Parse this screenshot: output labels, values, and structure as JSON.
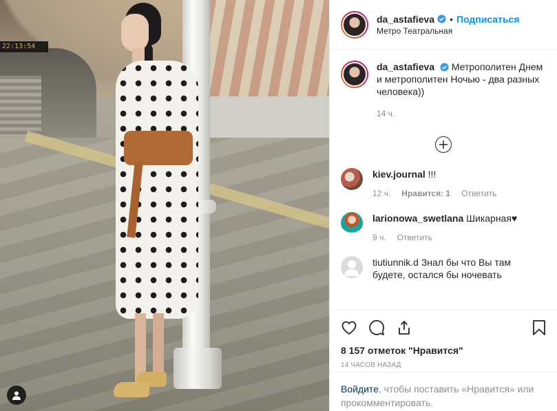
{
  "photo": {
    "station_sign_text": "22:13:54"
  },
  "header": {
    "username": "da_astafieva",
    "separator": "•",
    "follow_label": "Подписаться",
    "location": "Метро Театральная"
  },
  "caption": {
    "username": "da_astafieva",
    "text": "Метрополитен Днем и метрополитен Ночью - два разных человека))",
    "time": "14 ч."
  },
  "comments": [
    {
      "username": "kiev.journal",
      "text": "!!!",
      "time": "12 ч.",
      "likes_label": "Нравится: 1",
      "reply_label": "Ответить"
    },
    {
      "username": "larionowa_swetlana",
      "text": "Шикарная♥",
      "time": "9 ч.",
      "reply_label": "Ответить"
    },
    {
      "username": "tiutiunnik.d",
      "text": "Знал бы что Вы там будете, остался бы ночевать"
    }
  ],
  "actions": {
    "likes_count": "8 157 отметок \"Нравится\"",
    "posted_ago": "14 ЧАСОВ НАЗАД"
  },
  "login_prompt": {
    "link": "Войдите",
    "text": ", чтобы поставить «Нравится» или прокомментировать."
  },
  "colors": {
    "accent": "#0095f6",
    "verified": "#3897f0",
    "muted": "#8e8e8e",
    "link": "#00376b"
  },
  "icons": [
    "user-tag-icon",
    "verified-icon",
    "plus-circle-icon",
    "heart-icon",
    "comment-icon",
    "share-icon",
    "bookmark-icon"
  ]
}
